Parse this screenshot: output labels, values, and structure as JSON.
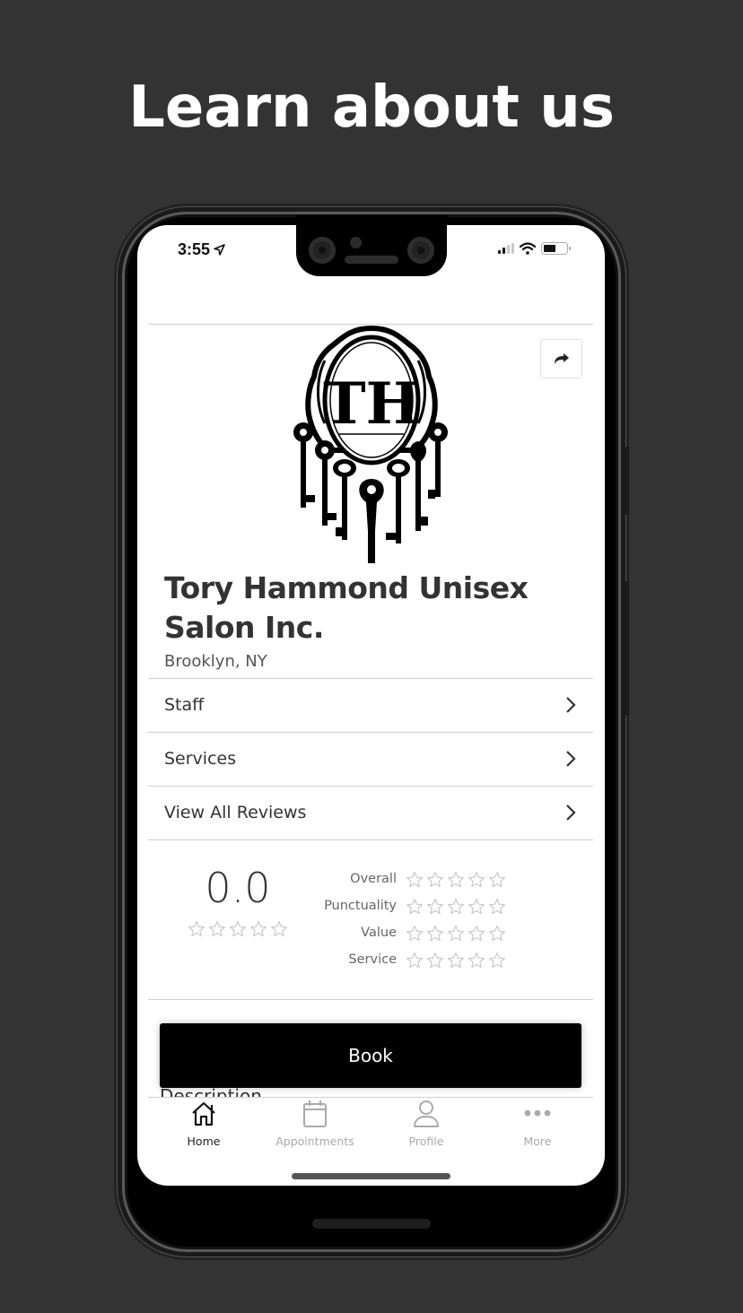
{
  "headline": "Learn about us",
  "status_bar": {
    "time": "3:55",
    "location_icon": "location-arrow-icon",
    "signal_icon": "cellular-signal-icon",
    "wifi_icon": "wifi-icon",
    "battery_icon": "battery-icon",
    "battery_level": 0.55
  },
  "business": {
    "logo_text": "TH",
    "name": "Tory Hammond Unisex Salon Inc.",
    "location": "Brooklyn, NY",
    "share_icon": "share-arrow-icon"
  },
  "nav_rows": [
    {
      "label": "Staff",
      "icon": "chevron-right-icon"
    },
    {
      "label": "Services",
      "icon": "chevron-right-icon"
    },
    {
      "label": "View All Reviews",
      "icon": "chevron-right-icon"
    }
  ],
  "ratings": {
    "overall_score": "0.0",
    "overall_stars_filled": 0,
    "max_stars": 5,
    "categories": [
      {
        "label": "Overall",
        "stars_filled": 0
      },
      {
        "label": "Punctuality",
        "stars_filled": 0
      },
      {
        "label": "Value",
        "stars_filled": 0
      },
      {
        "label": "Service",
        "stars_filled": 0
      }
    ]
  },
  "book_button": "Book",
  "description_heading": "Description",
  "tabbar": {
    "active": "Home",
    "tabs": [
      {
        "label": "Home",
        "icon": "home-icon"
      },
      {
        "label": "Appointments",
        "icon": "calendar-icon"
      },
      {
        "label": "Profile",
        "icon": "user-icon"
      },
      {
        "label": "More",
        "icon": "more-dots-icon"
      }
    ]
  },
  "colors": {
    "background": "#333333",
    "primary_button": "#000000",
    "text_dark": "#333333",
    "tab_inactive": "#aaaaaa",
    "star_empty": "#c8c8c8"
  }
}
